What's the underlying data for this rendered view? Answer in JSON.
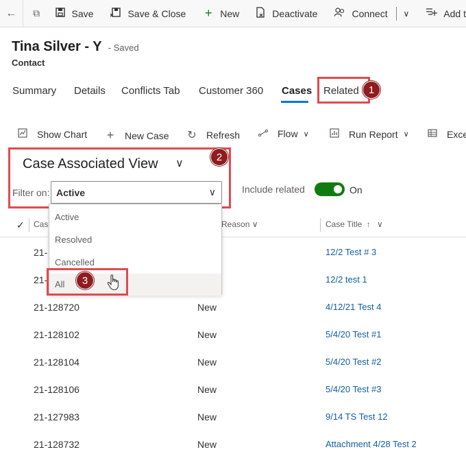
{
  "commandbar": {
    "save": "Save",
    "save_close": "Save & Close",
    "new": "New",
    "deactivate": "Deactivate",
    "connect": "Connect",
    "add_to": "Add t"
  },
  "record": {
    "name": "Tina Silver - Y",
    "status": "- Saved",
    "entity": "Contact"
  },
  "tabs": [
    "Summary",
    "Details",
    "Conflicts Tab",
    "Customer 360",
    "Cases",
    "Related"
  ],
  "active_tab": "Cases",
  "callouts": [
    "1",
    "2",
    "3"
  ],
  "subgrid_toolbar": {
    "show_chart": "Show Chart",
    "new_case": "New Case",
    "refresh": "Refresh",
    "flow": "Flow",
    "run_report": "Run Report",
    "excel": "Exce"
  },
  "view": {
    "title": "Case Associated View",
    "filter_label": "Filter on:",
    "filter_value": "Active",
    "include_related_label": "Include related",
    "include_related_state": "On"
  },
  "dropdown_options": [
    "Active",
    "Resolved",
    "Cancelled",
    "All"
  ],
  "grid": {
    "columns": [
      "Case",
      "Reason",
      "Case Title"
    ],
    "rows": [
      {
        "number": "21-",
        "status": "",
        "title": "12/2 Test # 3"
      },
      {
        "number": "21-",
        "status": "",
        "title": "12/2 test 1"
      },
      {
        "number": "21-128720",
        "status": "New",
        "title": "4/12/21 Test 4"
      },
      {
        "number": "21-128102",
        "status": "New",
        "title": "5/4/20 Test #1"
      },
      {
        "number": "21-128104",
        "status": "New",
        "title": "5/4/20 Test #2"
      },
      {
        "number": "21-128106",
        "status": "New",
        "title": "5/4/20 Test #3"
      },
      {
        "number": "21-127983",
        "status": "New",
        "title": "9/14 TS Test 12"
      },
      {
        "number": "21-128732",
        "status": "New",
        "title": "Attachment 4/28 Test 2"
      }
    ]
  },
  "colors": {
    "accent": "#0078d4",
    "callout": "#e04a4f",
    "badge": "#8f1c1f",
    "toggle_on": "#107c10",
    "link": "#115ea3"
  }
}
